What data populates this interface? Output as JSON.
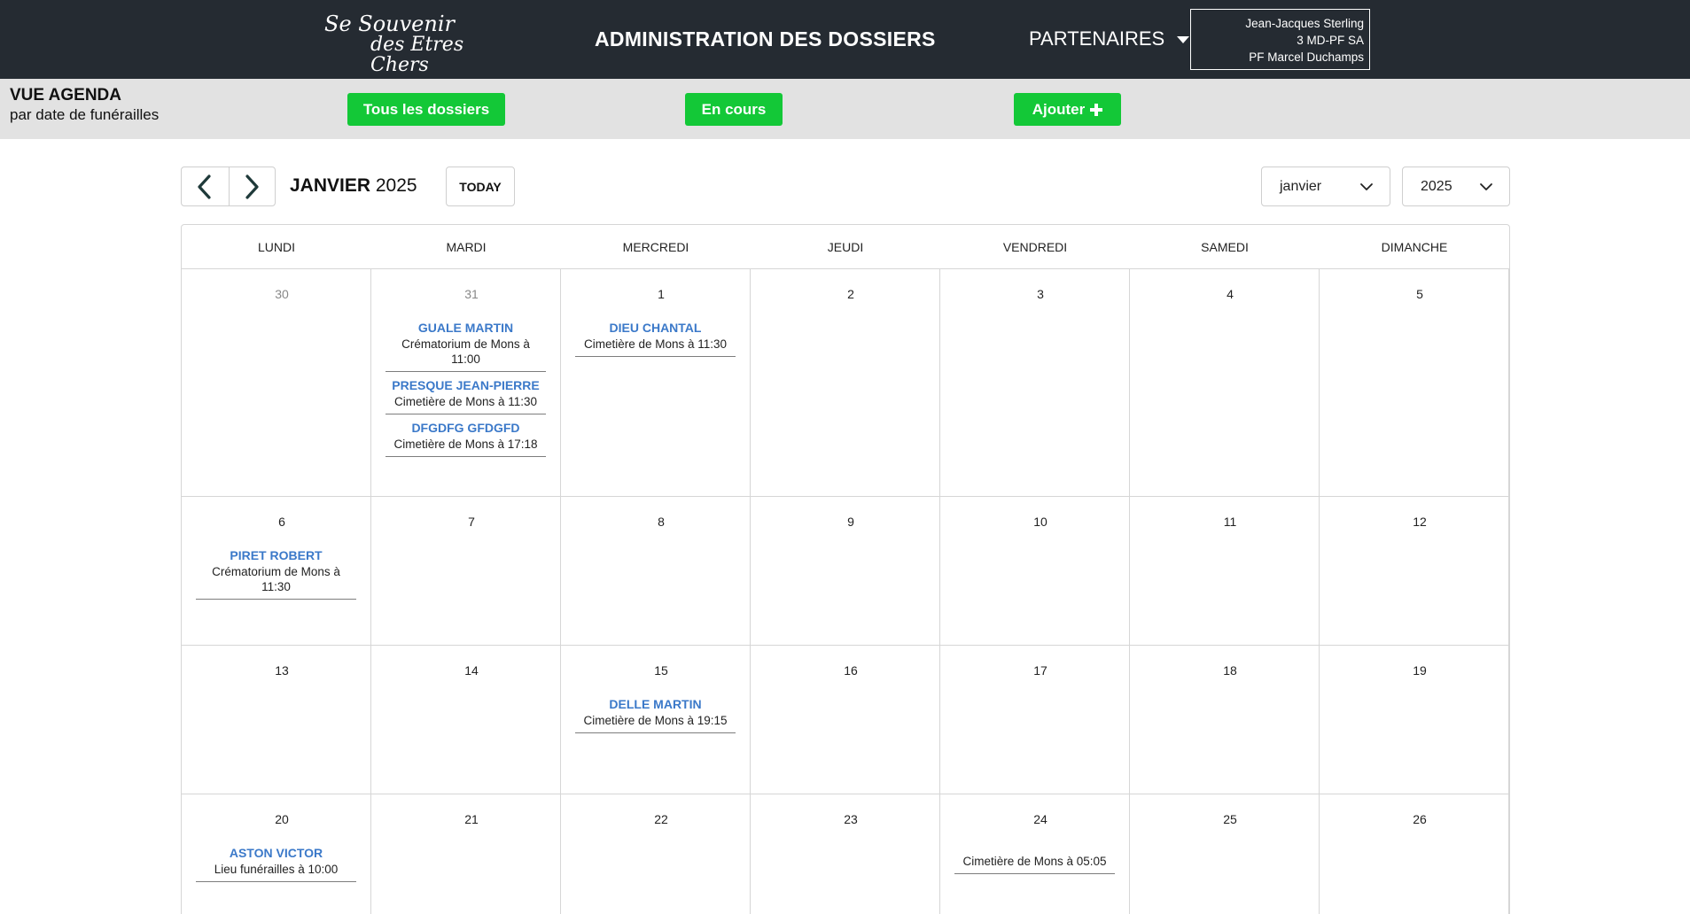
{
  "header": {
    "logo_line1": "Se Souvenir",
    "logo_line2": "des Etres Chers",
    "title": "ADMINISTRATION DES DOSSIERS",
    "partners_label": "PARTENAIRES",
    "user": {
      "name": "Jean-Jacques Sterling",
      "company": "3 MD-PF SA",
      "branch": "PF Marcel Duchamps"
    }
  },
  "subbar": {
    "view_title": "VUE AGENDA",
    "view_subtitle": "par date de funérailles",
    "buttons": {
      "all": "Tous les dossiers",
      "in_progress": "En cours",
      "add": "Ajouter"
    }
  },
  "toolbar": {
    "month": "JANVIER",
    "year": "2025",
    "today_label": "TODAY",
    "month_select_value": "janvier",
    "year_select_value": "2025"
  },
  "weekdays": [
    "LUNDI",
    "MARDI",
    "MERCREDI",
    "JEUDI",
    "VENDREDI",
    "SAMEDI",
    "DIMANCHE"
  ],
  "weeks": [
    {
      "days": [
        {
          "num": "30",
          "other": true,
          "events": []
        },
        {
          "num": "31",
          "other": true,
          "events": [
            {
              "name": "GUALE MARTIN",
              "location": "Crématorium de Mons à 11:00"
            },
            {
              "name": "PRESQUE JEAN-PIERRE",
              "location": "Cimetière de Mons à 11:30"
            },
            {
              "name": "DFGDFG GFDGFD",
              "location": "Cimetière de Mons à 17:18"
            }
          ]
        },
        {
          "num": "1",
          "events": [
            {
              "name": "DIEU CHANTAL",
              "location": "Cimetière de Mons à 11:30"
            }
          ]
        },
        {
          "num": "2",
          "events": []
        },
        {
          "num": "3",
          "events": []
        },
        {
          "num": "4",
          "events": []
        },
        {
          "num": "5",
          "events": []
        }
      ]
    },
    {
      "days": [
        {
          "num": "6",
          "events": [
            {
              "name": "PIRET ROBERT",
              "location": "Crématorium de Mons à 11:30"
            }
          ]
        },
        {
          "num": "7",
          "events": []
        },
        {
          "num": "8",
          "events": []
        },
        {
          "num": "9",
          "events": []
        },
        {
          "num": "10",
          "events": []
        },
        {
          "num": "11",
          "events": []
        },
        {
          "num": "12",
          "events": []
        }
      ]
    },
    {
      "days": [
        {
          "num": "13",
          "events": []
        },
        {
          "num": "14",
          "events": []
        },
        {
          "num": "15",
          "events": [
            {
              "name": "DELLE MARTIN",
              "location": "Cimetière de Mons à 19:15"
            }
          ]
        },
        {
          "num": "16",
          "events": []
        },
        {
          "num": "17",
          "events": []
        },
        {
          "num": "18",
          "events": []
        },
        {
          "num": "19",
          "events": []
        }
      ]
    },
    {
      "days": [
        {
          "num": "20",
          "events": [
            {
              "name": "ASTON VICTOR",
              "location": "Lieu funérailles à 10:00"
            }
          ]
        },
        {
          "num": "21",
          "events": []
        },
        {
          "num": "22",
          "events": []
        },
        {
          "num": "23",
          "events": []
        },
        {
          "num": "24",
          "events": [
            {
              "name": "",
              "location": "Cimetière de Mons à 05:05"
            }
          ]
        },
        {
          "num": "25",
          "events": []
        },
        {
          "num": "26",
          "events": []
        }
      ]
    }
  ],
  "colors": {
    "header_bg": "#252b32",
    "subbar_bg": "#e2e2e2",
    "button_green": "#13c837",
    "event_name_blue": "#3b79c9"
  }
}
